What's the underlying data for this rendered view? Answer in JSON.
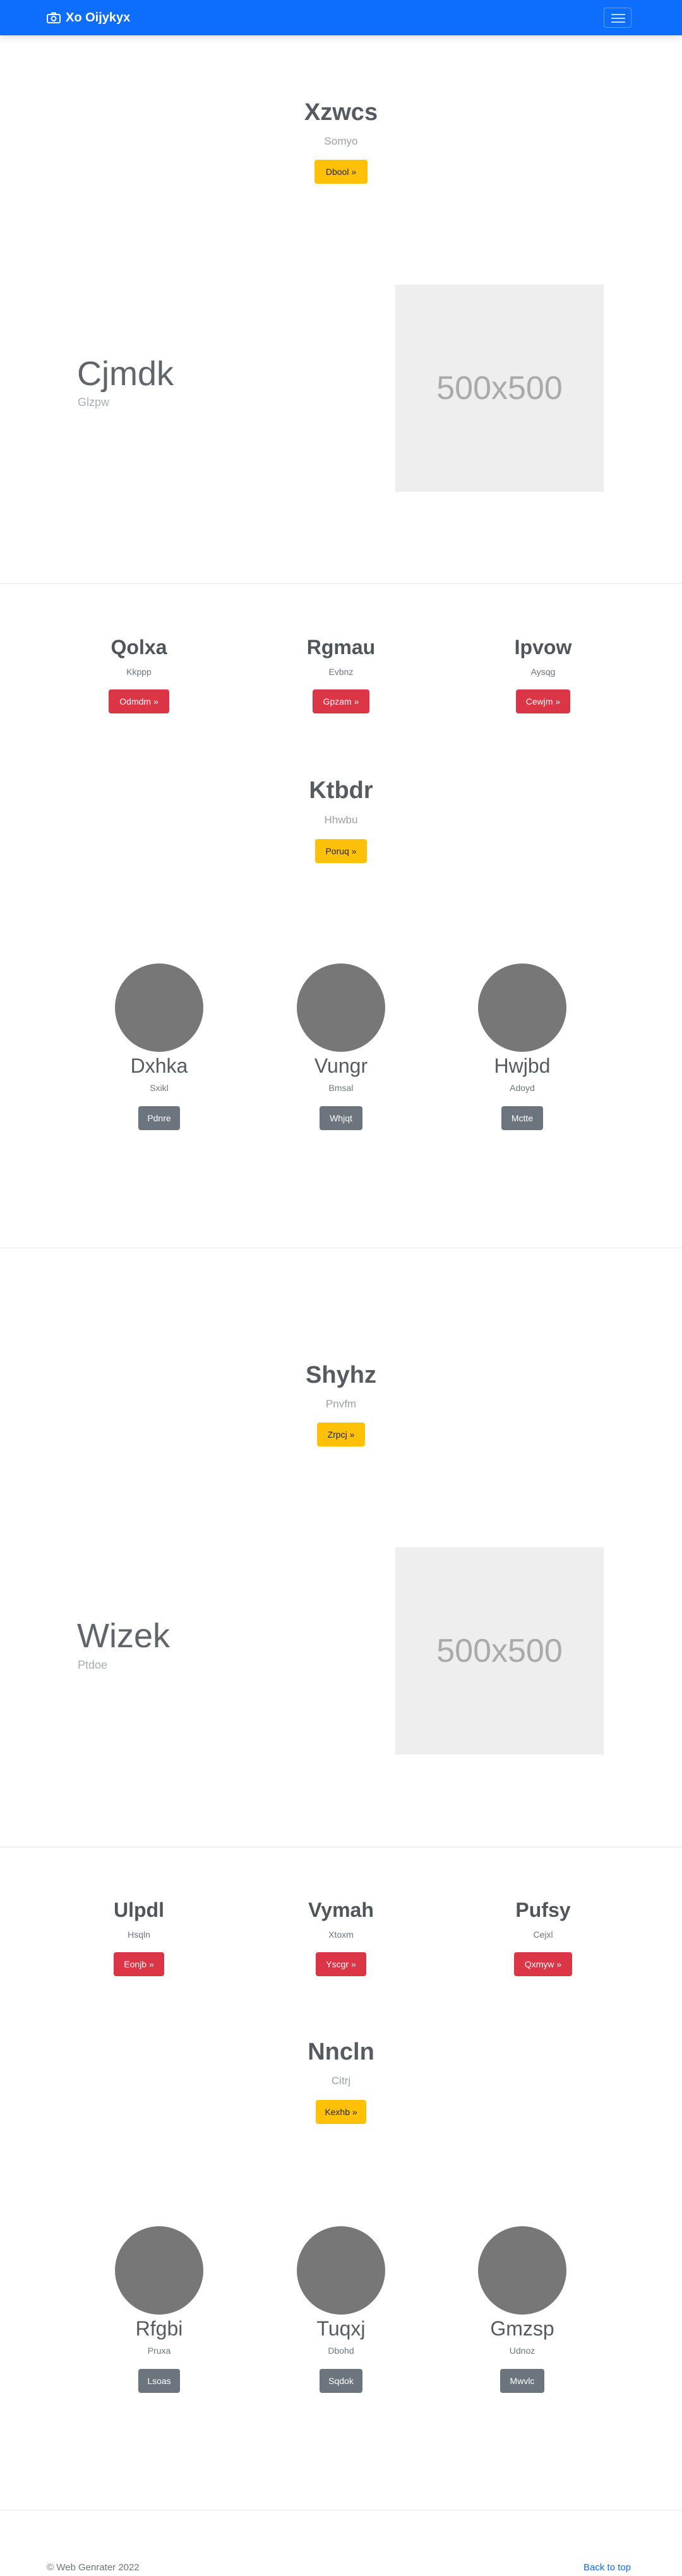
{
  "navbar": {
    "brand": "Xo Oijykyx",
    "brand_icon": "camera-icon",
    "toggler_icon": "hamburger-menu-icon",
    "color": "#0d6efd"
  },
  "hero1": {
    "title": "Xzwcs",
    "subtitle": "Somyo",
    "button": "Dbool »"
  },
  "feature1": {
    "title": "Cjmdk",
    "subtitle": "Glzpw",
    "image_text": "500x500"
  },
  "columns1": [
    {
      "title": "Qolxa",
      "text": "Kkppp",
      "button": "Odmdm »"
    },
    {
      "title": "Rgmau",
      "text": "Evbnz",
      "button": "Gpzam »"
    },
    {
      "title": "Ipvow",
      "text": "Aysqg",
      "button": "Cewjm »"
    }
  ],
  "hero2": {
    "title": "Ktbdr",
    "subtitle": "Hhwbu",
    "button": "Poruq »"
  },
  "people1": [
    {
      "name": "Dxhka",
      "text": "Sxikl",
      "button": "Pdnre"
    },
    {
      "name": "Vungr",
      "text": "Bmsal",
      "button": "Whjqt"
    },
    {
      "name": "Hwjbd",
      "text": "Adoyd",
      "button": "Mctte"
    }
  ],
  "hero3": {
    "title": "Shyhz",
    "subtitle": "Pnvfm",
    "button": "Zrpcj »"
  },
  "feature2": {
    "title": "Wizek",
    "subtitle": "Ptdoe",
    "image_text": "500x500"
  },
  "columns2": [
    {
      "title": "Ulpdl",
      "text": "Hsqln",
      "button": "Eonjb »"
    },
    {
      "title": "Vymah",
      "text": "Xtoxm",
      "button": "Yscgr »"
    },
    {
      "title": "Pufsy",
      "text": "Cejxl",
      "button": "Qxmyw »"
    }
  ],
  "hero4": {
    "title": "Nncln",
    "subtitle": "Citrj",
    "button": "Kexhb »"
  },
  "people2": [
    {
      "name": "Rfgbi",
      "text": "Pruxa",
      "button": "Lsoas"
    },
    {
      "name": "Tuqxj",
      "text": "Dbohd",
      "button": "Sqdok"
    },
    {
      "name": "Gmzsp",
      "text": "Udnoz",
      "button": "Mwvlc"
    }
  ],
  "footer": {
    "copyright": "© Web Genrater 2022",
    "back_to_top": "Back to top"
  }
}
